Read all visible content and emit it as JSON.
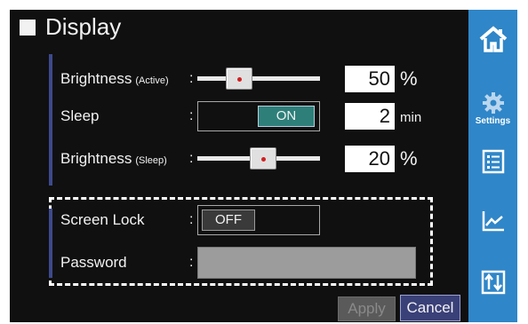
{
  "window": {
    "title": "Display"
  },
  "brightness_active": {
    "label": "Brightness",
    "label_small": "(Active)",
    "value": "50",
    "unit": "%",
    "slider_level": 0.3
  },
  "sleep": {
    "label": "Sleep",
    "toggle": "ON",
    "value": "2",
    "unit": "min"
  },
  "brightness_sleep": {
    "label": "Brightness",
    "label_small": "(Sleep)",
    "value": "20",
    "unit": "%",
    "slider_level": 0.55
  },
  "screen_lock": {
    "label": "Screen Lock",
    "toggle": "OFF"
  },
  "password": {
    "label": "Password",
    "value": ""
  },
  "colon": ":",
  "buttons": {
    "apply": "Apply",
    "cancel": "Cancel"
  },
  "sidebar": {
    "items": [
      {
        "icon": "home-icon",
        "label": ""
      },
      {
        "icon": "gear-icon",
        "label": "Settings"
      },
      {
        "icon": "checklist-icon",
        "label": ""
      },
      {
        "icon": "line-chart-icon",
        "label": ""
      },
      {
        "icon": "transfer-icon",
        "label": ""
      }
    ]
  },
  "colors": {
    "sidebar": "#2f86c8",
    "on_button": "#2e7f7a",
    "cancel_button": "#3a4078",
    "accent_bar": "#3c4a8c"
  }
}
